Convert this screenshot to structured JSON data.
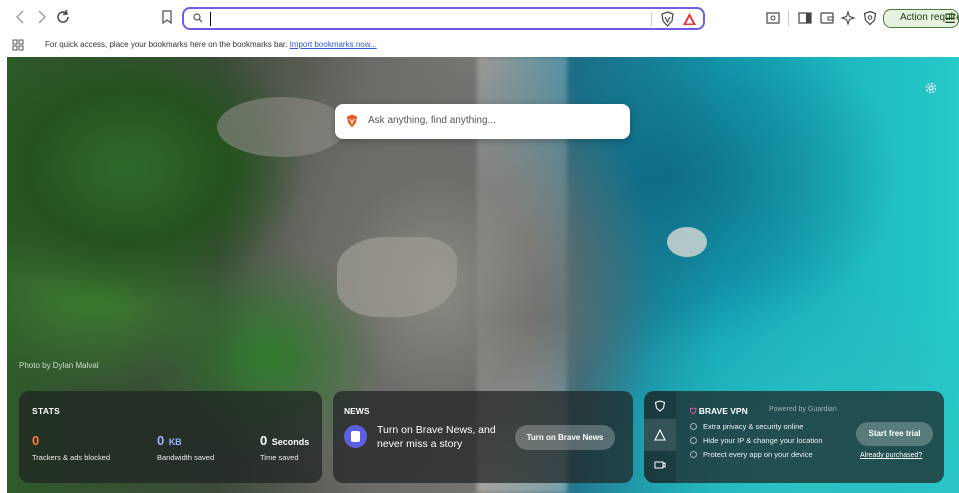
{
  "toolbar": {
    "back_icon": "chevron-left",
    "forward_icon": "chevron-right",
    "reload_icon": "reload",
    "bookmark_icon": "bookmark",
    "address_value": "",
    "action_required": "Action required",
    "colors": {
      "address_border": "#6c5ce7",
      "action_border": "#4a7c3b",
      "action_bg": "#e7f1df"
    }
  },
  "bookmarks_bar": {
    "message": "For quick access, place your bookmarks here on the bookmarks bar.",
    "import_link": "Import bookmarks now..."
  },
  "ntp": {
    "search_placeholder": "Ask anything, find anything...",
    "photo_credit": "Photo by Dylan Malval"
  },
  "stats": {
    "title": "STATS",
    "items": [
      {
        "value": "0",
        "unit": "",
        "label": "Trackers & ads blocked",
        "color": "#ff7a3d"
      },
      {
        "value": "0",
        "unit": "KB",
        "label": "Bandwidth saved",
        "color": "#9bb4ff"
      },
      {
        "value": "0",
        "unit": "Seconds",
        "label": "Time saved",
        "color": "#ffffff"
      }
    ]
  },
  "news": {
    "title": "NEWS",
    "text": "Turn on Brave News, and never miss a story",
    "button": "Turn on Brave News"
  },
  "vpn": {
    "title": "BRAVE VPN",
    "powered": "Powered by Guardian",
    "features": [
      "Extra privacy & security online",
      "Hide your IP & change your location",
      "Protect every app on your device"
    ],
    "trial_button": "Start free trial",
    "purchased_link": "Already purchased?"
  }
}
